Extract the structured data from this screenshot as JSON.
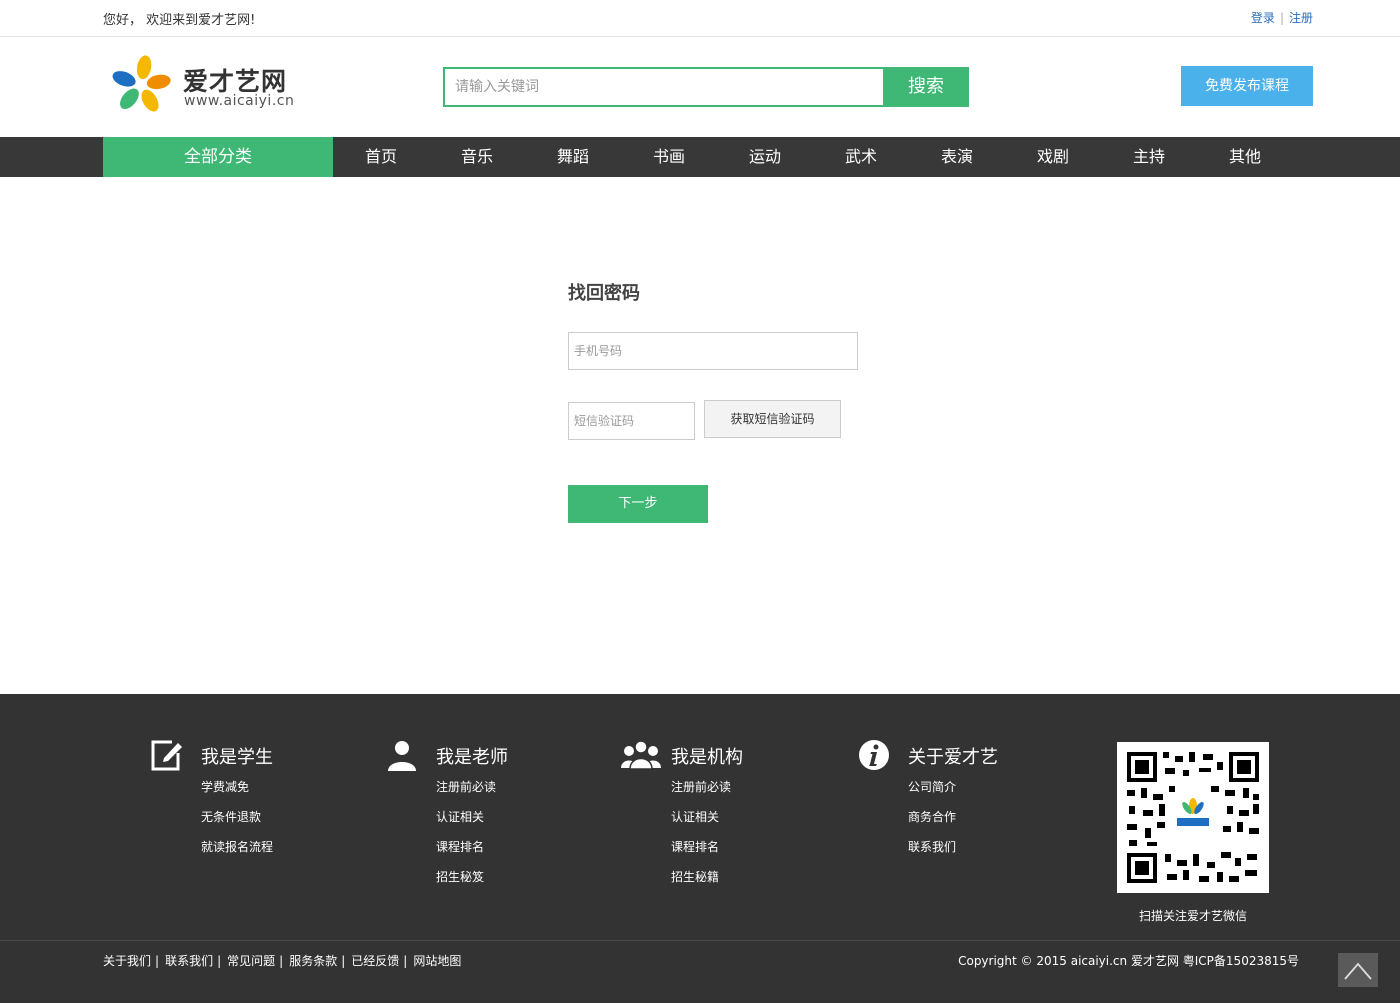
{
  "topbar": {
    "welcome": "您好， 欢迎来到爱才艺网!",
    "login": "登录",
    "sep": "|",
    "register": "注册"
  },
  "header": {
    "logo_name": "爱才艺网",
    "logo_url": "www.aicaiyi.cn",
    "search_placeholder": "请输入关键词",
    "search_button": "搜索",
    "publish_button": "免费发布课程"
  },
  "nav": {
    "all": "全部分类",
    "items": [
      "首页",
      "音乐",
      "舞蹈",
      "书画",
      "运动",
      "武术",
      "表演",
      "戏剧",
      "主持",
      "其他"
    ]
  },
  "form": {
    "title": "找回密码",
    "phone_placeholder": "手机号码",
    "sms_placeholder": "短信验证码",
    "get_code": "获取短信验证码",
    "next": "下一步"
  },
  "footer": {
    "columns": [
      {
        "title": "我是学生",
        "icon": "edit-icon",
        "links": [
          "学费减免",
          "无条件退款",
          "就读报名流程"
        ]
      },
      {
        "title": "我是老师",
        "icon": "user-icon",
        "links": [
          "注册前必读",
          "认证相关",
          "课程排名",
          "招生秘笈"
        ]
      },
      {
        "title": "我是机构",
        "icon": "group-icon",
        "links": [
          "注册前必读",
          "认证相关",
          "课程排名",
          "招生秘籍"
        ]
      },
      {
        "title": "关于爱才艺",
        "icon": "info-icon",
        "links": [
          "公司简介",
          "商务合作",
          "联系我们"
        ]
      }
    ],
    "qr_caption": "扫描关注爱才艺微信",
    "bottom_links": [
      "关于我们",
      "联系我们",
      "常见问题",
      "服务条款",
      "已经反馈",
      "网站地图"
    ],
    "bottom_sep": "|",
    "copyright": "Copyright © 2015 aicaiyi.cn 爱才艺网 粤ICP备15023815号"
  },
  "colors": {
    "accent": "#3eb874",
    "publish": "#4ab1eb",
    "nav_bg": "#383838",
    "footer_bg": "#333333"
  }
}
